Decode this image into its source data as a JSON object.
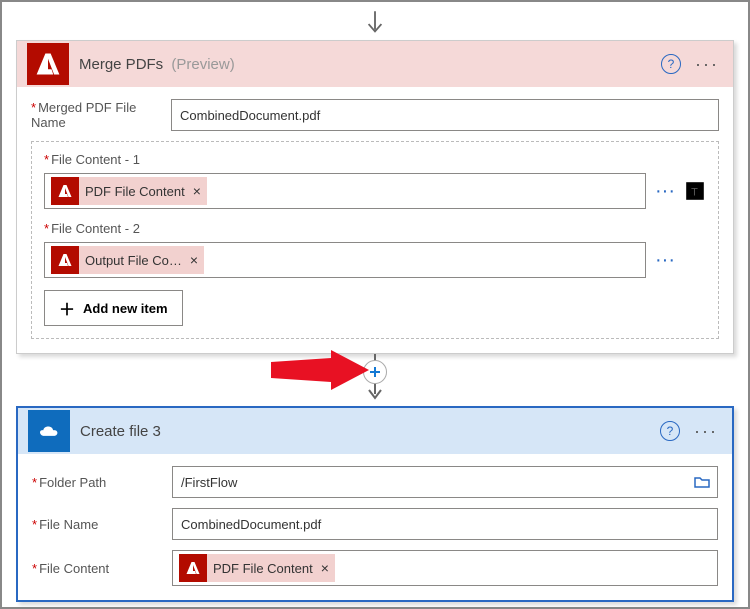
{
  "mergeCard": {
    "title": "Merge PDFs",
    "suffix": "(Preview)",
    "help": "?",
    "menu": "···",
    "fileName": {
      "label": "Merged PDF File Name",
      "value": "CombinedDocument.pdf"
    },
    "content1": {
      "label": "File Content - 1",
      "tokenText": "PDF File Content",
      "tokenClose": "×",
      "more": "···"
    },
    "content2": {
      "label": "File Content - 2",
      "tokenText": "Output File Co…",
      "tokenClose": "×",
      "more": "···"
    },
    "addBtn": "Add new item"
  },
  "createCard": {
    "title": "Create file 3",
    "help": "?",
    "menu": "···",
    "folder": {
      "label": "Folder Path",
      "value": "/FirstFlow"
    },
    "fileName": {
      "label": "File Name",
      "value": "CombinedDocument.pdf"
    },
    "fileContent": {
      "label": "File Content",
      "tokenText": "PDF File Content",
      "tokenClose": "×"
    }
  }
}
